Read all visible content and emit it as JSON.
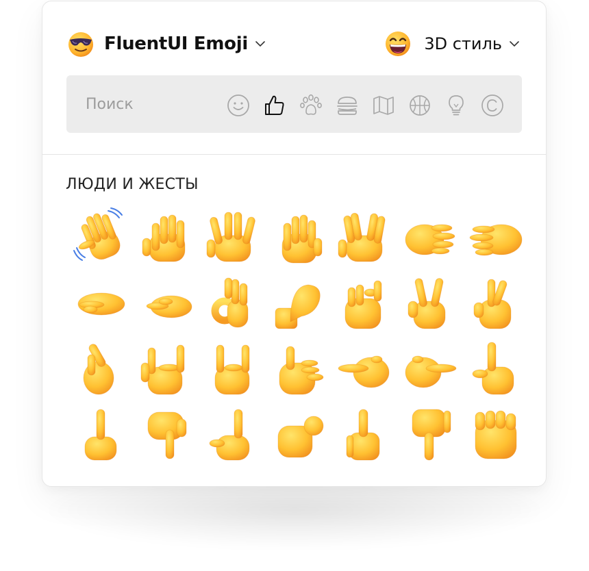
{
  "header": {
    "library_label": "FluentUI Emoji",
    "library_icon": "smiling-face-with-sunglasses-icon",
    "style_label": "3D стиль",
    "style_icon": "grinning-face-with-smiling-eyes-icon"
  },
  "search": {
    "placeholder": "Поиск",
    "value": ""
  },
  "categories": [
    {
      "name": "smileys",
      "icon": "smiley-icon",
      "selected": false
    },
    {
      "name": "people-gestures",
      "icon": "thumbs-up-icon",
      "selected": true
    },
    {
      "name": "animals",
      "icon": "paw-icon",
      "selected": false
    },
    {
      "name": "food",
      "icon": "burger-icon",
      "selected": false
    },
    {
      "name": "travel",
      "icon": "map-icon",
      "selected": false
    },
    {
      "name": "activities",
      "icon": "ball-icon",
      "selected": false
    },
    {
      "name": "objects",
      "icon": "lightbulb-icon",
      "selected": false
    },
    {
      "name": "symbols",
      "icon": "copyright-icon",
      "selected": false
    }
  ],
  "section_title": "ЛЮДИ И ЖЕСТЫ",
  "emojis": [
    "waving-hand",
    "raised-back-of-hand",
    "hand-with-fingers-splayed",
    "raised-hand",
    "vulcan-salute",
    "rightwards-hand",
    "leftwards-hand",
    "palm-down-hand",
    "palm-up-hand",
    "ok-hand",
    "pinched-fingers",
    "pinching-hand",
    "victory-hand",
    "crossed-fingers",
    "hand-with-index-finger-and-thumb-crossed",
    "love-you-gesture",
    "sign-of-the-horns",
    "call-me-hand",
    "backhand-index-pointing-left",
    "backhand-index-pointing-right",
    "backhand-index-pointing-up",
    "middle-finger",
    "backhand-index-pointing-down",
    "index-pointing-up",
    "index-pointing-at-the-viewer",
    "thumbs-up",
    "thumbs-down",
    "raised-fist"
  ],
  "colors": {
    "skin_light": "#FFD54A",
    "skin_mid": "#FFBE2E",
    "skin_dark": "#F29A1E",
    "accent_blue": "#4A7FE5",
    "search_bg": "#ECECEC",
    "icon_gray": "#A8A8A8"
  }
}
